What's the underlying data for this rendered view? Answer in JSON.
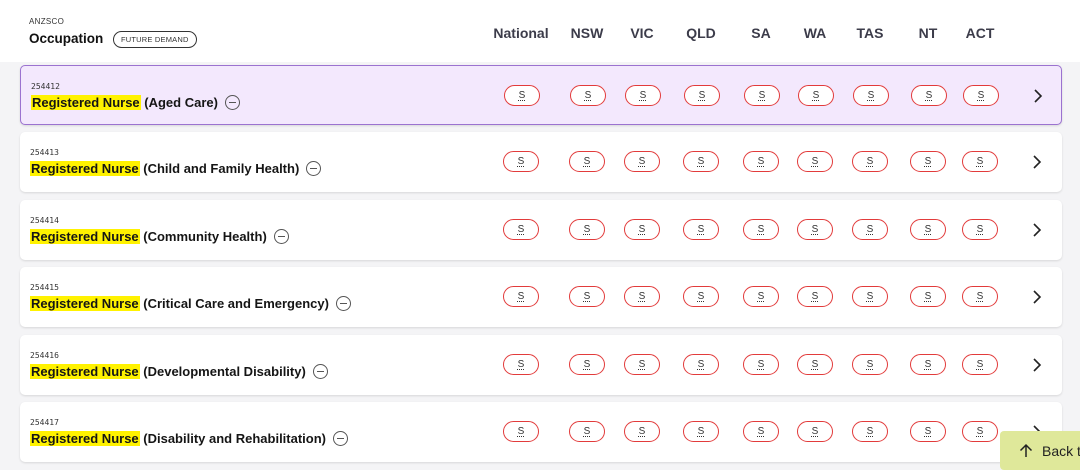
{
  "header": {
    "anzsco_label": "ANZSCO",
    "occupation_label": "Occupation",
    "future_demand_badge": "FUTURE DEMAND",
    "columns": [
      "National",
      "NSW",
      "VIC",
      "QLD",
      "SA",
      "WA",
      "TAS",
      "NT",
      "ACT"
    ]
  },
  "rows": [
    {
      "code": "254412",
      "highlight": "Registered Nurse",
      "rest": " (Aged Care)",
      "active": true,
      "statuses": [
        "S",
        "S",
        "S",
        "S",
        "S",
        "S",
        "S",
        "S",
        "S"
      ]
    },
    {
      "code": "254413",
      "highlight": "Registered Nurse",
      "rest": " (Child and Family Health)",
      "active": false,
      "statuses": [
        "S",
        "S",
        "S",
        "S",
        "S",
        "S",
        "S",
        "S",
        "S"
      ]
    },
    {
      "code": "254414",
      "highlight": "Registered Nurse",
      "rest": " (Community Health)",
      "active": false,
      "statuses": [
        "S",
        "S",
        "S",
        "S",
        "S",
        "S",
        "S",
        "S",
        "S"
      ]
    },
    {
      "code": "254415",
      "highlight": "Registered Nurse",
      "rest": " (Critical Care and Emergency)",
      "active": false,
      "statuses": [
        "S",
        "S",
        "S",
        "S",
        "S",
        "S",
        "S",
        "S",
        "S"
      ]
    },
    {
      "code": "254416",
      "highlight": "Registered Nurse",
      "rest": " (Developmental Disability)",
      "active": false,
      "statuses": [
        "S",
        "S",
        "S",
        "S",
        "S",
        "S",
        "S",
        "S",
        "S"
      ]
    },
    {
      "code": "254417",
      "highlight": "Registered Nurse",
      "rest": " (Disability and Rehabilitation)",
      "active": false,
      "statuses": [
        "S",
        "S",
        "S",
        "S",
        "S",
        "S",
        "S",
        "S",
        "S"
      ]
    }
  ],
  "back_button": {
    "label": "Back t",
    "icon": "arrow-up-icon"
  },
  "colors": {
    "accent_border": "#9b72d0",
    "active_bg": "#f3e8fd",
    "status_border": "#e23b3b",
    "highlight": "#fff200",
    "back_bg": "#dfe89a"
  }
}
